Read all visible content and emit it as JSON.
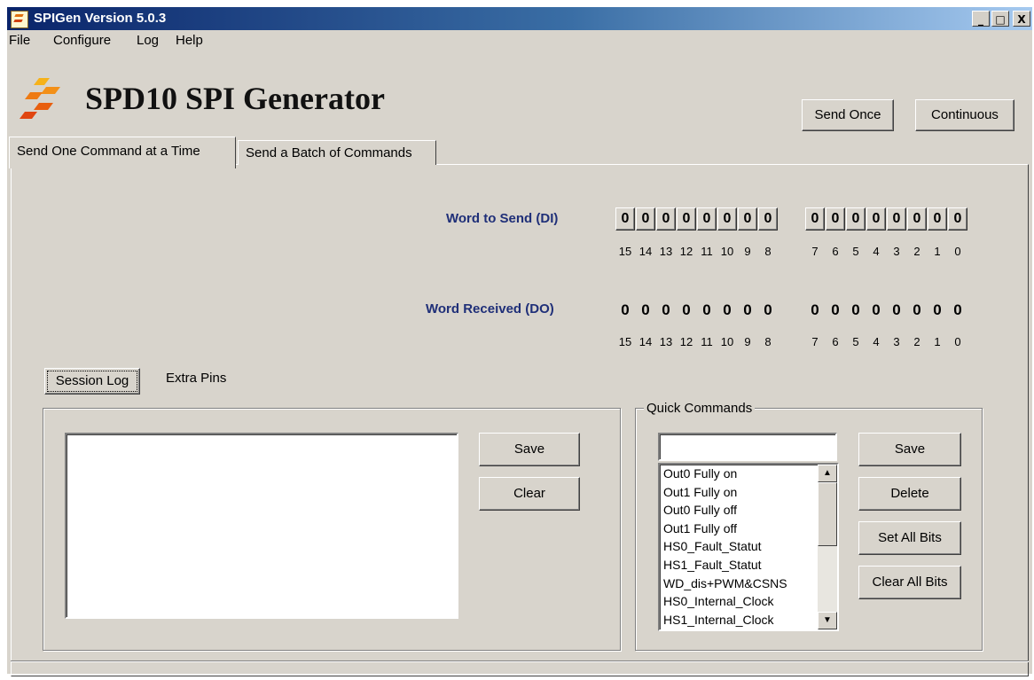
{
  "window": {
    "title": "SPIGen Version 5.0.3",
    "minimize": "_",
    "maximize": "□",
    "close": "X"
  },
  "menu": [
    "File",
    "Configure",
    "Log",
    "Help"
  ],
  "header": {
    "app_title": "SPD10 SPI Generator",
    "send_once": "Send Once",
    "continuous": "Continuous"
  },
  "tabs": {
    "one": "Send One Command at a Time",
    "batch": "Send a Batch of Commands"
  },
  "word_send": {
    "label": "Word to Send (DI)",
    "bits": [
      "0",
      "0",
      "0",
      "0",
      "0",
      "0",
      "0",
      "0",
      "0",
      "0",
      "0",
      "0",
      "0",
      "0",
      "0",
      "0"
    ]
  },
  "word_recv": {
    "label": "Word Received (DO)",
    "bits": [
      "0",
      "0",
      "0",
      "0",
      "0",
      "0",
      "0",
      "0",
      "0",
      "0",
      "0",
      "0",
      "0",
      "0",
      "0",
      "0"
    ]
  },
  "bit_numbers": [
    "15",
    "14",
    "13",
    "12",
    "11",
    "10",
    "9",
    "8",
    "7",
    "6",
    "5",
    "4",
    "3",
    "2",
    "1",
    "0"
  ],
  "log": {
    "session_tab": "Session Log",
    "extra_tab": "Extra Pins",
    "save": "Save",
    "clear": "Clear"
  },
  "quick": {
    "title": "Quick Commands",
    "input_value": "",
    "items": [
      "Out0 Fully on",
      "Out1 Fully on",
      "Out0 Fully off",
      "Out1 Fully off",
      "HS0_Fault_Statut",
      "HS1_Fault_Statut",
      "WD_dis+PWM&CSNS",
      "HS0_Internal_Clock",
      "HS1_Internal_Clock"
    ],
    "save": "Save",
    "delete": "Delete",
    "set_all": "Set All Bits",
    "clear_all": "Clear All Bits"
  }
}
